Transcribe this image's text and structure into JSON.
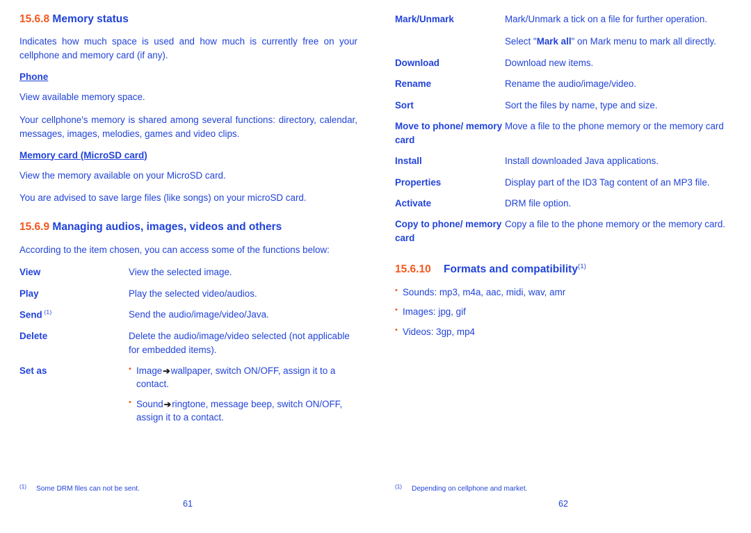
{
  "left_page": {
    "sections": [
      {
        "number": "15.6.8",
        "title": "Memory status",
        "intro": "Indicates how much space is used and how much is currently free on your cellphone and memory card (if any).",
        "sub1_head": "Phone",
        "sub1_p1": "View available memory space.",
        "sub1_p2": "Your cellphone's memory is shared among several functions: directory, calendar, messages, images, melodies, games and video clips.",
        "sub2_head": "Memory card (MicroSD card)",
        "sub2_p1": "View the memory available on your MicroSD card.",
        "sub2_p2": "You are advised to save large files (like songs) on your microSD card."
      },
      {
        "number": "15.6.9",
        "title": "Managing audios, images, videos and others",
        "intro": "According to the item chosen, you can access some of the functions below:"
      }
    ],
    "rows": [
      {
        "term": "View",
        "footnote_mark": "",
        "desc": "View the selected image."
      },
      {
        "term": "Play",
        "footnote_mark": "",
        "desc": "Play the selected video/audios."
      },
      {
        "term": "Send",
        "footnote_mark": "(1)",
        "desc": "Send the audio/image/video/Java."
      },
      {
        "term": "Delete",
        "footnote_mark": "",
        "desc": "Delete the audio/image/video selected (not applicable for embedded items)."
      }
    ],
    "setas": {
      "term": "Set as",
      "bullets": [
        {
          "before": "Image",
          "arrow": "➔",
          "after": "wallpaper, switch ON/OFF, assign it to a contact."
        },
        {
          "before": "Sound",
          "arrow": "➔",
          "after": "ringtone, message beep, switch ON/OFF, assign it to a contact."
        }
      ]
    },
    "footnote": {
      "mark": "(1)",
      "text": "Some DRM files can not be sent."
    },
    "page_number": "61"
  },
  "right_page": {
    "rows": [
      {
        "term": "Mark/Unmark",
        "blocks": [
          {
            "pre": "Mark/Unmark a tick on a file for further operation.",
            "bold": "",
            "post": ""
          },
          {
            "pre": "Select \"",
            "bold": "Mark all",
            "post": "\" on Mark menu to mark all directly."
          }
        ]
      },
      {
        "term": "Download",
        "blocks": [
          {
            "pre": "Download new items.",
            "bold": "",
            "post": ""
          }
        ]
      },
      {
        "term": "Rename",
        "blocks": [
          {
            "pre": "Rename the audio/image/video.",
            "bold": "",
            "post": ""
          }
        ]
      },
      {
        "term": "Sort",
        "blocks": [
          {
            "pre": "Sort the files by name, type and size.",
            "bold": "",
            "post": ""
          }
        ]
      },
      {
        "term": "Move to phone/ memory card",
        "blocks": [
          {
            "pre": "Move a file to the phone memory or the memory card",
            "bold": "",
            "post": ""
          }
        ]
      },
      {
        "term": "Install",
        "blocks": [
          {
            "pre": "Install downloaded Java applications.",
            "bold": "",
            "post": ""
          }
        ]
      },
      {
        "term": "Properties",
        "blocks": [
          {
            "pre": "Display part of the ID3 Tag content of an MP3 file.",
            "bold": "",
            "post": ""
          }
        ]
      },
      {
        "term": "Activate",
        "blocks": [
          {
            "pre": "DRM file option.",
            "bold": "",
            "post": ""
          }
        ]
      },
      {
        "term": "Copy to phone/ memory card",
        "blocks": [
          {
            "pre": "Copy a file to the phone memory or the memory card.",
            "bold": "",
            "post": ""
          }
        ]
      }
    ],
    "section": {
      "number": "15.6.10",
      "title": "Formats and compatibility",
      "footnote_mark": "(1)"
    },
    "formats": [
      "Sounds: mp3, m4a, aac, midi, wav, amr",
      "Images: jpg, gif",
      "Videos: 3gp, mp4"
    ],
    "footnote": {
      "mark": "(1)",
      "text": "Depending on cellphone and market."
    },
    "page_number": "62"
  }
}
